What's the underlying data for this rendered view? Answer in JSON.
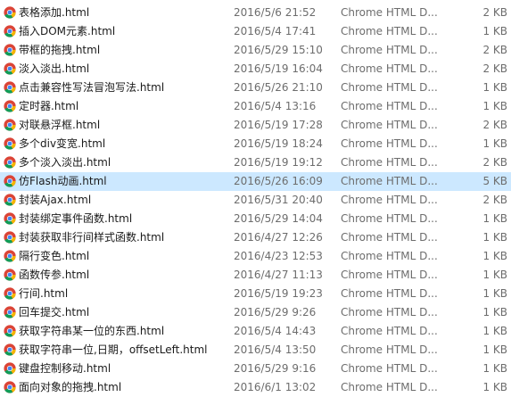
{
  "file_list": {
    "icon": "chrome-html-file-icon",
    "colors": {
      "selected_row_background": "#cce8ff",
      "name_text": "#1a1a1a",
      "meta_text": "#6d6d6d"
    },
    "rows": [
      {
        "name": "表格添加.html",
        "modified": "2016/5/6 21:52",
        "type": "Chrome HTML D...",
        "size": "2 KB"
      },
      {
        "name": "插入DOM元素.html",
        "modified": "2016/5/4 17:41",
        "type": "Chrome HTML D...",
        "size": "1 KB"
      },
      {
        "name": "带框的拖拽.html",
        "modified": "2016/5/29 15:10",
        "type": "Chrome HTML D...",
        "size": "2 KB"
      },
      {
        "name": "淡入淡出.html",
        "modified": "2016/5/19 16:04",
        "type": "Chrome HTML D...",
        "size": "2 KB"
      },
      {
        "name": "点击兼容性写法冒泡写法.html",
        "modified": "2016/5/26 21:10",
        "type": "Chrome HTML D...",
        "size": "1 KB"
      },
      {
        "name": "定时器.html",
        "modified": "2016/5/4 13:16",
        "type": "Chrome HTML D...",
        "size": "1 KB"
      },
      {
        "name": "对联悬浮框.html",
        "modified": "2016/5/19 17:28",
        "type": "Chrome HTML D...",
        "size": "2 KB"
      },
      {
        "name": "多个div变宽.html",
        "modified": "2016/5/19 18:24",
        "type": "Chrome HTML D...",
        "size": "1 KB"
      },
      {
        "name": "多个淡入淡出.html",
        "modified": "2016/5/19 19:12",
        "type": "Chrome HTML D...",
        "size": "2 KB"
      },
      {
        "name": "仿Flash动画.html",
        "modified": "2016/5/26 16:09",
        "type": "Chrome HTML D...",
        "size": "5 KB",
        "selected": true
      },
      {
        "name": "封装Ajax.html",
        "modified": "2016/5/31 20:40",
        "type": "Chrome HTML D...",
        "size": "2 KB"
      },
      {
        "name": "封装绑定事件函数.html",
        "modified": "2016/5/29 14:04",
        "type": "Chrome HTML D...",
        "size": "1 KB"
      },
      {
        "name": "封装获取非行间样式函数.html",
        "modified": "2016/4/27 12:26",
        "type": "Chrome HTML D...",
        "size": "1 KB"
      },
      {
        "name": "隔行变色.html",
        "modified": "2016/4/23 12:53",
        "type": "Chrome HTML D...",
        "size": "1 KB"
      },
      {
        "name": "函数传参.html",
        "modified": "2016/4/27 11:13",
        "type": "Chrome HTML D...",
        "size": "1 KB"
      },
      {
        "name": "行间.html",
        "modified": "2016/5/19 19:23",
        "type": "Chrome HTML D...",
        "size": "1 KB"
      },
      {
        "name": "回车提交.html",
        "modified": "2016/5/29 9:26",
        "type": "Chrome HTML D...",
        "size": "1 KB"
      },
      {
        "name": "获取字符串某一位的东西.html",
        "modified": "2016/5/4 14:43",
        "type": "Chrome HTML D...",
        "size": "1 KB"
      },
      {
        "name": "获取字符串一位,日期，offsetLeft.html",
        "modified": "2016/5/4 13:50",
        "type": "Chrome HTML D...",
        "size": "1 KB"
      },
      {
        "name": "键盘控制移动.html",
        "modified": "2016/5/29 9:16",
        "type": "Chrome HTML D...",
        "size": "1 KB"
      },
      {
        "name": "面向对象的拖拽.html",
        "modified": "2016/6/1 13:02",
        "type": "Chrome HTML D...",
        "size": "1 KB"
      }
    ]
  }
}
